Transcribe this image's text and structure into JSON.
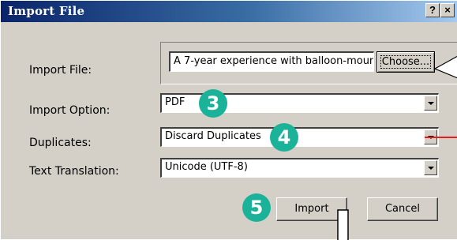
{
  "window": {
    "title": "Import File",
    "help_glyph": "?",
    "close_glyph": "×"
  },
  "form": {
    "import_file": {
      "label": "Import File:",
      "value": "A 7-year experience with balloon-moun",
      "choose_label": "Choose..."
    },
    "import_option": {
      "label": "Import Option:",
      "selected": "PDF"
    },
    "duplicates": {
      "label": "Duplicates:",
      "selected": "Discard Duplicates"
    },
    "text_translation": {
      "label": "Text Translation:",
      "selected": "Unicode (UTF-8)"
    }
  },
  "buttons": {
    "import_label": "Import",
    "cancel_label": "Cancel"
  },
  "callouts": {
    "step3": "3",
    "step4": "4",
    "step5": "5"
  },
  "colors": {
    "title_gradient_start": "#0a246a",
    "title_gradient_end": "#a6caf0",
    "dialog_bg": "#d4d0c8",
    "callout_badge": "#1ab39a",
    "callout_red_line": "#e02020"
  },
  "icons": {
    "help": "help-icon",
    "close": "close-icon",
    "dropdown": "chevron-down-icon"
  }
}
